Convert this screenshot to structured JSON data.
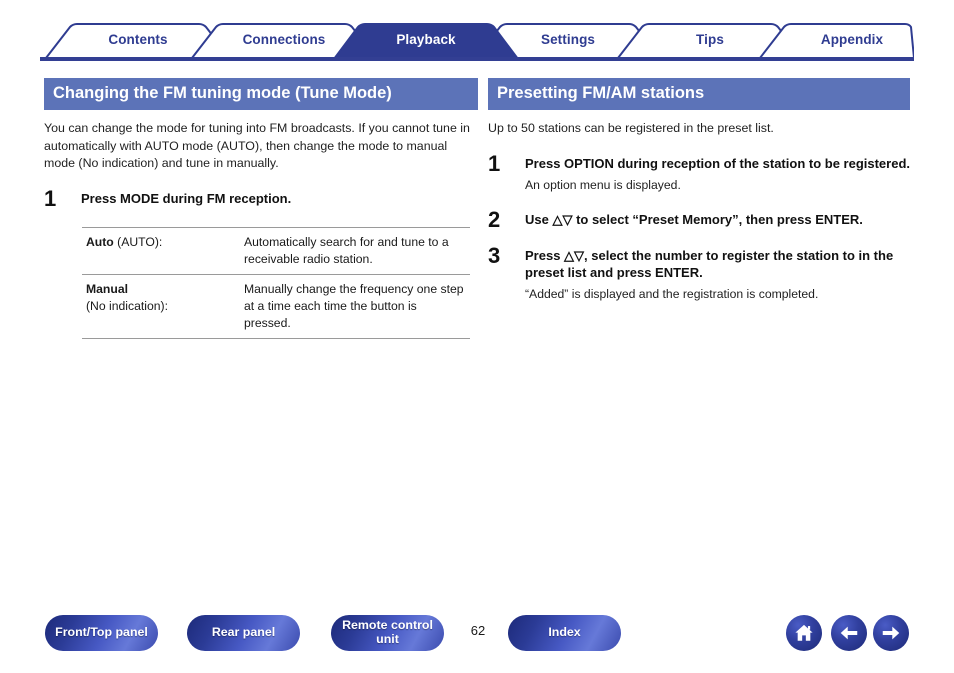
{
  "tabs": [
    {
      "label": "Contents",
      "active": false
    },
    {
      "label": "Connections",
      "active": false
    },
    {
      "label": "Playback",
      "active": true
    },
    {
      "label": "Settings",
      "active": false
    },
    {
      "label": "Tips",
      "active": false
    },
    {
      "label": "Appendix",
      "active": false
    }
  ],
  "left": {
    "heading": "Changing the FM tuning mode (Tune Mode)",
    "intro": "You can change the mode for tuning into FM broadcasts. If you cannot tune in automatically with AUTO mode (AUTO), then change the mode to manual mode (No indication) and tune in manually.",
    "steps": [
      {
        "num": "1",
        "title": "Press MODE during FM reception.",
        "note": ""
      }
    ],
    "table": [
      {
        "term_bold": "Auto",
        "term_rest": " (AUTO):",
        "desc": "Automatically search for and tune to a receivable radio station."
      },
      {
        "term_bold": "Manual",
        "term_rest": "(No indication):",
        "desc": "Manually change the frequency one step at a time each time the button is pressed."
      }
    ]
  },
  "right": {
    "heading": "Presetting FM/AM stations",
    "intro": "Up to 50 stations can be registered in the preset list.",
    "steps": [
      {
        "num": "1",
        "title": "Press OPTION during reception of the station to be registered.",
        "note": "An option menu is displayed."
      },
      {
        "num": "2",
        "title": "Use △▽ to select “Preset Memory”, then press ENTER.",
        "note": ""
      },
      {
        "num": "3",
        "title": "Press △▽, select the number to register the station to in the preset list and press ENTER.",
        "note": "“Added” is displayed and the registration is completed."
      }
    ]
  },
  "footer": {
    "buttons": [
      {
        "label": "Front/Top panel",
        "name": "front-top-panel-button"
      },
      {
        "label": "Rear panel",
        "name": "rear-panel-button"
      },
      {
        "label": "Remote control unit",
        "name": "remote-control-unit-button"
      },
      {
        "label": "Index",
        "name": "index-button"
      }
    ],
    "page_number": "62",
    "nav": [
      {
        "icon": "home-icon"
      },
      {
        "icon": "arrow-left-icon"
      },
      {
        "icon": "arrow-right-icon"
      }
    ]
  },
  "colors": {
    "tab_stroke": "#2f3c91",
    "tab_active_fill": "#2f3c91",
    "section_header_bg": "#5c73b8",
    "rule": "#9a9a9a"
  }
}
